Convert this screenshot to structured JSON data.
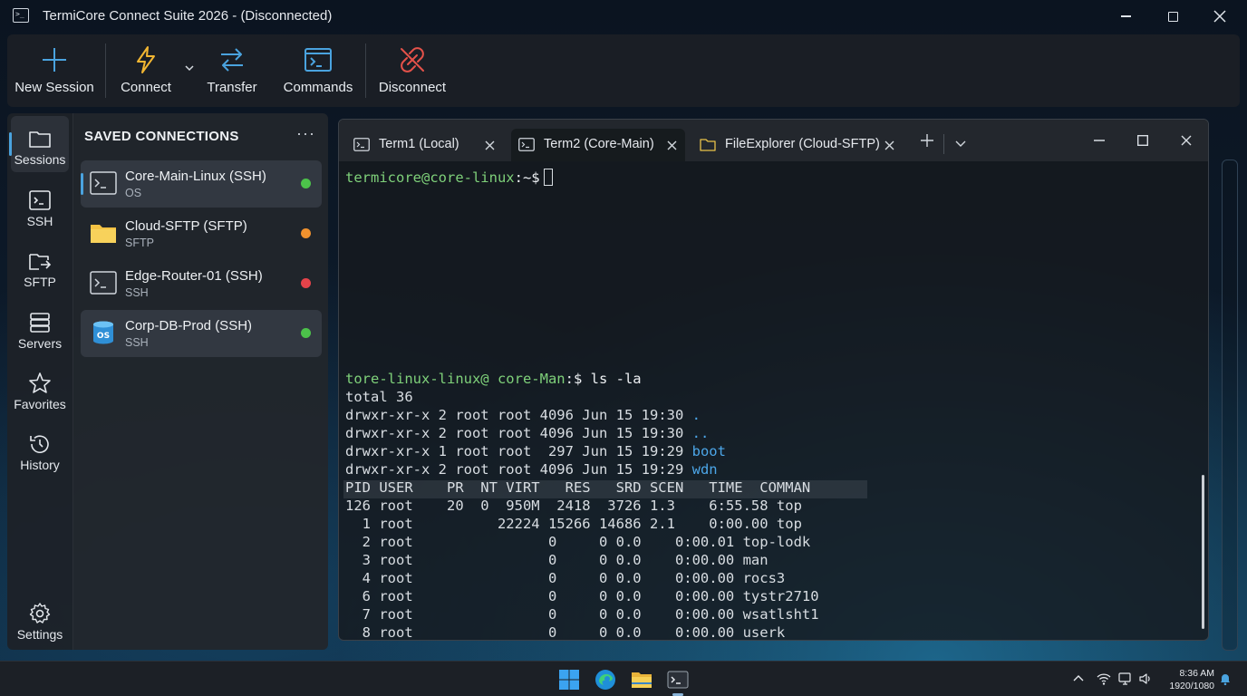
{
  "window": {
    "title": "TermiCore Connect Suite 2026 - (Disconnected)"
  },
  "ribbon": {
    "new_session": "New Session",
    "connect": "Connect",
    "transfer": "Transfer",
    "commands": "Commands",
    "disconnect": "Disconnect"
  },
  "rail": {
    "sessions": "Sessions",
    "ssh": "SSH",
    "sftp": "SFTP",
    "servers": "Servers",
    "favorites": "Favorites",
    "history": "History",
    "settings": "Settings"
  },
  "panel": {
    "title": "SAVED CONNECTIONS",
    "more": "···",
    "connections": [
      {
        "name": "Core-Main-Linux (SSH)",
        "sub": "OS",
        "status_color": "#4cc24a",
        "icon": "terminal-icon"
      },
      {
        "name": "Cloud-SFTP (SFTP)",
        "sub": "SFTP",
        "status_color": "#f0922e",
        "icon": "folder-icon"
      },
      {
        "name": "Edge-Router-01 (SSH)",
        "sub": "SSH",
        "status_color": "#e5434a",
        "icon": "terminal-icon"
      },
      {
        "name": "Corp-DB-Prod (SSH)",
        "sub": "SSH",
        "status_color": "#4cc24a",
        "icon": "database-icon",
        "icon_text": "OS"
      }
    ]
  },
  "tabs": [
    {
      "label": "Term1 (Local)",
      "icon": "terminal-icon"
    },
    {
      "label": "Term2 (Core-Main)",
      "icon": "terminal-icon",
      "active": true
    },
    {
      "label": "FileExplorer (Cloud-SFTP)",
      "icon": "folder-icon"
    }
  ],
  "terminal": {
    "prompt1_user": "termicore@core-linux",
    "prompt1_path": ":~$",
    "prompt2_user": "tore-linux-linux@ core-Man",
    "prompt2_rest": ":$ ls -la",
    "total": "total 36",
    "ls": [
      {
        "perm": "drwxr-xr-x 2 root root 4096 Jun 15 19:30 ",
        "name": "."
      },
      {
        "perm": "drwxr-xr-x 2 root root 4096 Jun 15 19:30 ",
        "name": ".."
      },
      {
        "perm": "drwxr-xr-x 1 root root  297 Jun 15 19:29 ",
        "name": "boot"
      },
      {
        "perm": "drwxr-xr-x 2 root root 4096 Jun 15 19:29 ",
        "name": "wdn"
      }
    ],
    "top_header": "PID USER    PR  NT VIRT   RES   SRD SCEN   TIME  COMMAN",
    "top_rows": [
      "126 root    20  0  950M  2418  3726 1.3    6:55.58 top",
      "  1 root          22224 15266 14686 2.1    0:00.00 top",
      "  2 root                0     0 0.0    0:00.01 top-lodk",
      "  3 root                0     0 0.0    0:00.00 man",
      "  4 root                0     0 0.0    0:00.00 rocs3",
      "  6 root                0     0 0.0    0:00.00 tystr2710",
      "  7 root                0     0 0.0    0:00.00 wsatlsht1",
      "  8 root                0     0 0.0    0:00.00 userk"
    ]
  },
  "taskbar": {
    "time": "8:36 AM",
    "date": "1920/1080"
  }
}
